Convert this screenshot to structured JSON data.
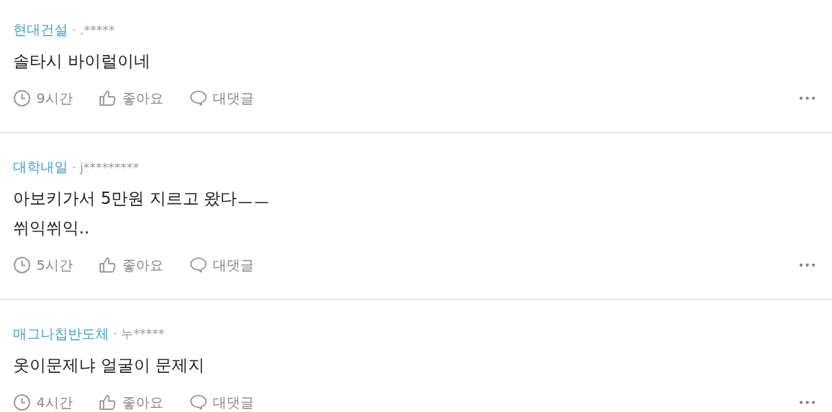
{
  "comments": [
    {
      "author": "현대건설",
      "user": "· .*****",
      "text": [
        "솔타시 바이럴이네"
      ],
      "time": "9시간",
      "like": "좋아요",
      "reply": "대댓글"
    },
    {
      "author": "대학내일",
      "user": "· j*********",
      "text": [
        "아보키가서 5만원 지르고 왔다ㅡㅡ",
        "쒸익쒸익.."
      ],
      "time": "5시간",
      "like": "좋아요",
      "reply": "대댓글"
    },
    {
      "author": "매그나칩반도체",
      "user": "· 누*****",
      "text": [
        "옷이문제냐 얼굴이 문제지"
      ],
      "time": "4시간",
      "like": "좋아요",
      "reply": "대댓글"
    }
  ]
}
